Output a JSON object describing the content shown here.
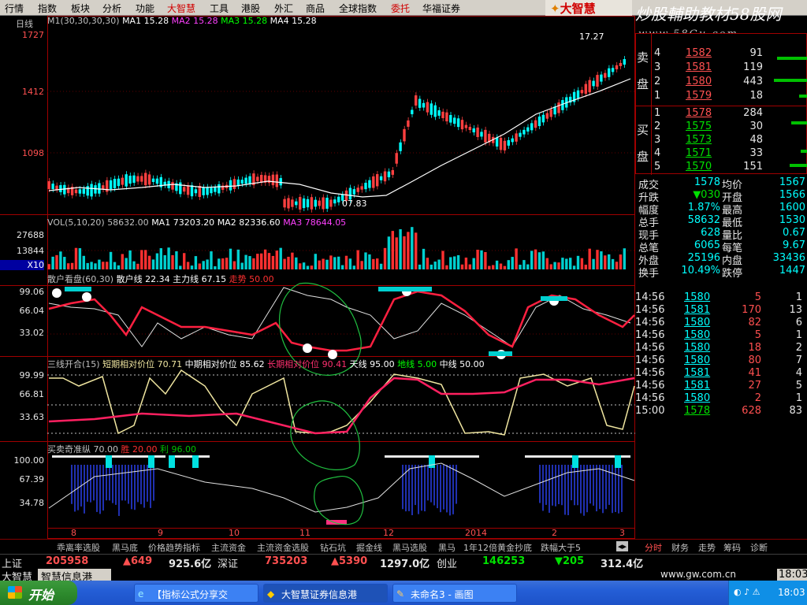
{
  "menu": {
    "items": [
      "行情",
      "指数",
      "板块",
      "分析",
      "功能",
      "大智慧",
      "工具",
      "港股",
      "外汇",
      "商品",
      "全球指数",
      "委托",
      "华福证券"
    ],
    "logo_text": "大智慧"
  },
  "brand": {
    "title": "炒股輔助教材58股网",
    "url": "www.58Gu.com"
  },
  "main_chart": {
    "period": "日线",
    "ma_legend": [
      {
        "text": "M1(30,30,30,30)",
        "color": "#c0c0c0"
      },
      {
        "text": "MA1 15.28",
        "color": "#ffffff"
      },
      {
        "text": "MA2 15.28",
        "color": "#ff40ff"
      },
      {
        "text": "MA3 15.28",
        "color": "#00ff00"
      },
      {
        "text": "MA4 15.28",
        "color": "#ffffff"
      }
    ],
    "y_labels": [
      "1727",
      "1412",
      "1098"
    ],
    "high_label": "17.27",
    "low_label": "07.83"
  },
  "volume": {
    "legend": [
      "VOL(5,10,20)",
      "58632.00",
      "MA1 73203.20",
      "MA2 82336.60",
      "MA3 78644.05"
    ],
    "y_labels": [
      "27688",
      "13844",
      "X10"
    ]
  },
  "ind1": {
    "legend": [
      "散户看盘(60,30)",
      "散户线 22.34",
      "主力线 67.15",
      "走势 50.00"
    ],
    "y_labels": [
      "99.06",
      "66.04",
      "33.02"
    ]
  },
  "ind2": {
    "legend": [
      "三线开合(15)",
      "短期相对价位 70.71",
      "中期相对价位 85.62",
      "长期相对价位 90.41",
      "天线 95.00",
      "地线 5.00",
      "中线 50.00"
    ],
    "y_labels": [
      "99.99",
      "66.81",
      "33.63"
    ]
  },
  "ind3": {
    "legend": [
      "买卖奇准纵 70.00",
      "胜 20.00",
      "利 96.00"
    ],
    "y_labels": [
      "100.00",
      "67.39",
      "34.78"
    ]
  },
  "x_labels": [
    "8",
    "9",
    "10",
    "11",
    "12",
    "2014",
    "2",
    "3"
  ],
  "tabs": [
    "乖离率选股",
    "黑马底",
    "价格趋势指标",
    "主流资金",
    "主流资金选股",
    "钻石坑",
    "掘金线",
    "黑马选股",
    "黑马",
    "1年12倍黄金抄底",
    "跌幅大于5"
  ],
  "right_tabs": [
    "分时",
    "财务",
    "走势",
    "筹码",
    "诊断"
  ],
  "order_book": {
    "sell_label": [
      "卖",
      "盘"
    ],
    "buy_label": [
      "买",
      "盘"
    ],
    "sell": [
      {
        "level": "4",
        "price": "1582",
        "vol": "91"
      },
      {
        "level": "3",
        "price": "1581",
        "vol": "119"
      },
      {
        "level": "2",
        "price": "1580",
        "vol": "443"
      },
      {
        "level": "1",
        "price": "1579",
        "vol": "18"
      }
    ],
    "buy": [
      {
        "level": "1",
        "price": "1578",
        "vol": "284"
      },
      {
        "level": "2",
        "price": "1575",
        "vol": "30"
      },
      {
        "level": "3",
        "price": "1573",
        "vol": "48"
      },
      {
        "level": "4",
        "price": "1571",
        "vol": "33"
      },
      {
        "level": "5",
        "price": "1570",
        "vol": "151"
      }
    ]
  },
  "quote": [
    {
      "l1": "成交",
      "v1": "1578",
      "l2": "均价",
      "v2": "1567"
    },
    {
      "l1": "升跌",
      "v1": "▼030",
      "l2": "开盘",
      "v2": "1566"
    },
    {
      "l1": "幅度",
      "v1": "1.87%",
      "l2": "最高",
      "v2": "1600"
    },
    {
      "l1": "总手",
      "v1": "58632",
      "l2": "最低",
      "v2": "1530"
    },
    {
      "l1": "现手",
      "v1": "628",
      "l2": "量比",
      "v2": "0.67"
    },
    {
      "l1": "总笔",
      "v1": "6065",
      "l2": "每笔",
      "v2": "9.67"
    },
    {
      "l1": "外盘",
      "v1": "25196",
      "l2": "内盘",
      "v2": "33436"
    },
    {
      "l1": "换手",
      "v1": "10.49%",
      "l2": "跌停",
      "v2": "1447"
    }
  ],
  "ticks": [
    {
      "time": "14:56",
      "price": "1580",
      "vol": "5",
      "n": "1"
    },
    {
      "time": "14:56",
      "price": "1581",
      "vol": "170",
      "n": "13"
    },
    {
      "time": "14:56",
      "price": "1580",
      "vol": "82",
      "n": "6"
    },
    {
      "time": "14:56",
      "price": "1580",
      "vol": "5",
      "n": "1"
    },
    {
      "time": "14:56",
      "price": "1580",
      "vol": "18",
      "n": "2"
    },
    {
      "time": "14:56",
      "price": "1580",
      "vol": "80",
      "n": "7"
    },
    {
      "time": "14:56",
      "price": "1581",
      "vol": "41",
      "n": "4"
    },
    {
      "time": "14:56",
      "price": "1581",
      "vol": "27",
      "n": "5"
    },
    {
      "time": "14:56",
      "price": "1580",
      "vol": "2",
      "n": "1"
    },
    {
      "time": "15:00",
      "price": "1578",
      "vol": "628",
      "n": "83"
    }
  ],
  "ticker": {
    "row1": [
      "上证",
      "205958",
      "▲649",
      "925.6亿",
      "深证",
      "735203",
      "▲5390",
      "1297.0亿",
      "创业",
      "146253",
      "▼205",
      "312.4亿"
    ],
    "row2": [
      "大智慧",
      "智慧信息港",
      "www.gw.com.cn",
      "18:03"
    ]
  },
  "taskbar": {
    "start": "开始",
    "buttons": [
      "【指标公式分享交",
      "大智慧证券信息港",
      "未命名3 - 画图"
    ],
    "clock": "18:03"
  }
}
